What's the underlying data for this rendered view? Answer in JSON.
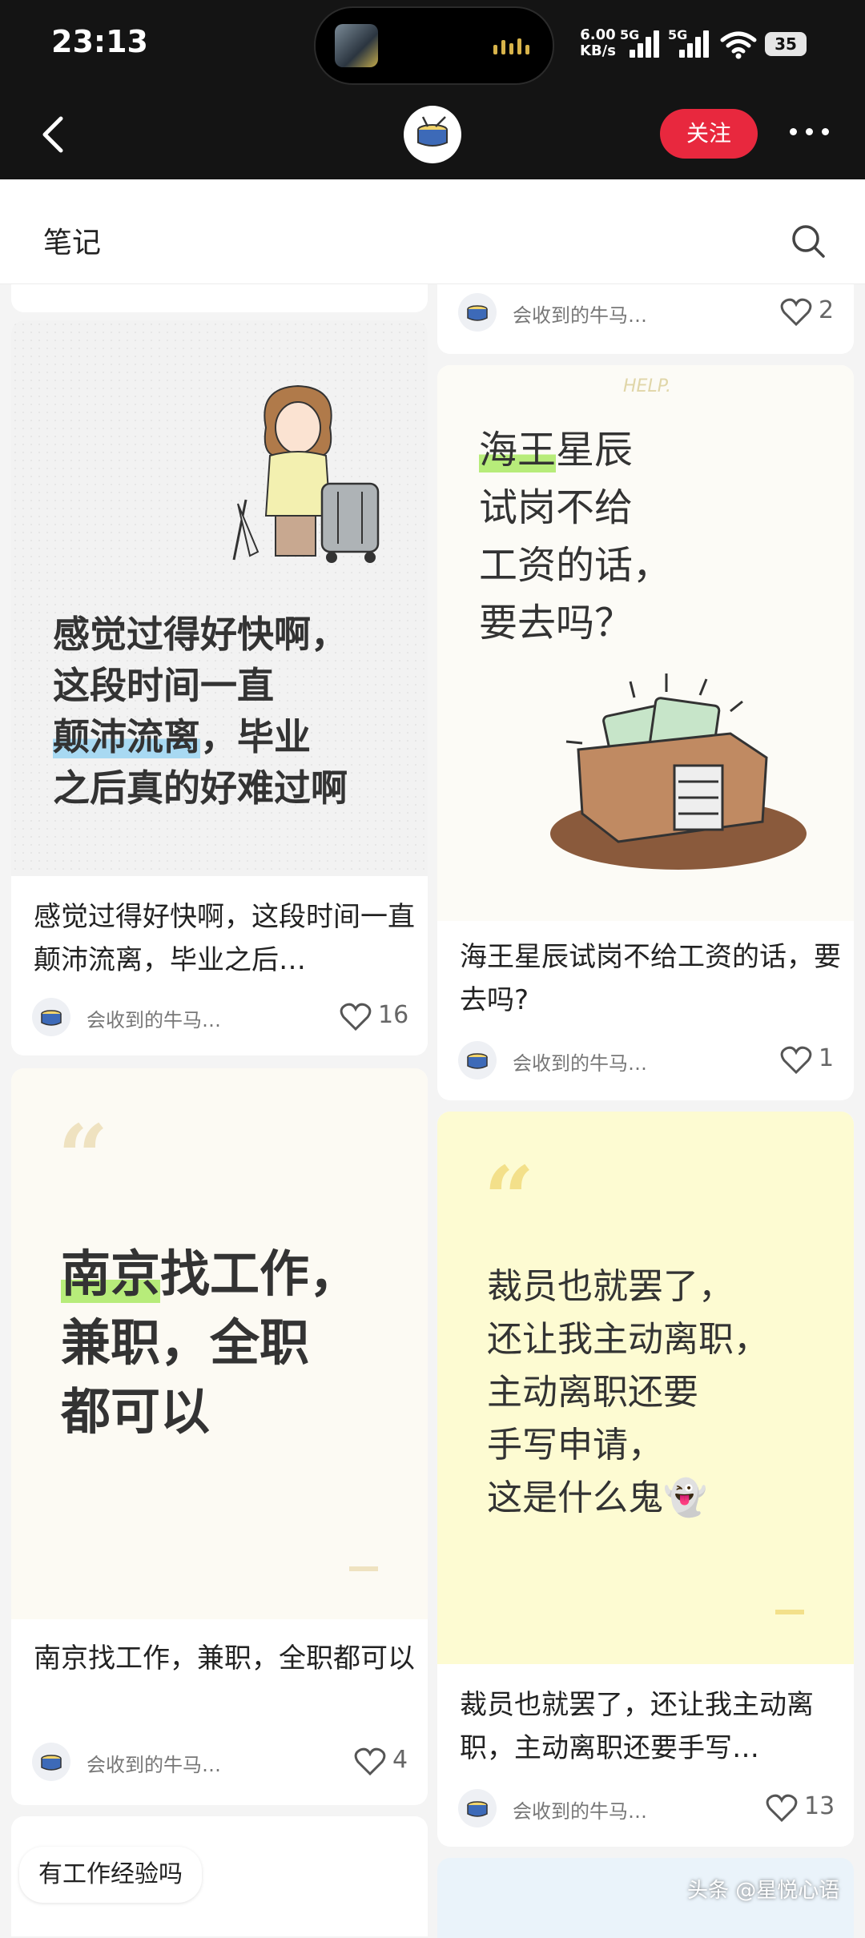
{
  "status_bar": {
    "time": "23:13",
    "net_speed_value": "6.00",
    "net_speed_unit": "KB/s",
    "signal1_label": "5G",
    "signal2_label": "5G",
    "battery": "35"
  },
  "nav": {
    "back_icon": "chevron-left-icon",
    "follow_label": "关注",
    "more_icon": "more-dots-icon"
  },
  "section": {
    "title": "笔记",
    "search_icon": "search-icon"
  },
  "left_column": {
    "card1": {
      "image_text_lines": [
        "感觉过得好快啊，",
        "这段时间一直",
        "颠沛流离，毕业",
        "之后真的好难过啊"
      ],
      "image_highlight": "颠沛流离",
      "caption": "感觉过得好快啊，这段时间一直颠沛流离，毕业之后…",
      "author": "会收到的牛马…",
      "likes": "16"
    },
    "card2": {
      "quote_mark": "“",
      "image_text_lines": [
        "南京找工作，",
        "兼职，全职",
        "都可以"
      ],
      "image_highlight": "南京",
      "caption": "南京找工作，兼职，全职都可以",
      "author": "会收到的牛马…",
      "likes": "4"
    },
    "card3": {
      "caption": "有工作经验吗"
    }
  },
  "right_column": {
    "card0": {
      "author": "会收到的牛马…",
      "likes": "2"
    },
    "card1": {
      "help_text": "HELP.",
      "image_text_lines": [
        "海王星辰",
        "试岗不给",
        "工资的话，",
        "要去吗？"
      ],
      "image_highlight": "海王",
      "caption": "海王星辰试岗不给工资的话，要去吗?",
      "author": "会收到的牛马…",
      "likes": "1"
    },
    "card2": {
      "quote_mark": "“",
      "image_text_lines": [
        "裁员也就罢了，",
        "还让我主动离职，",
        "主动离职还要",
        "手写申请，",
        "这是什么鬼👻"
      ],
      "caption": "裁员也就罢了，还让我主动离职，主动离职还要手写…",
      "author": "会收到的牛马…",
      "likes": "13"
    }
  },
  "watermark": "头条 @星悦心语",
  "colors": {
    "follow_red": "#e8283e",
    "highlight_blue": "#a8d9f2",
    "highlight_green": "#b7ec7a",
    "quote_yellow": "#f3e08a"
  }
}
